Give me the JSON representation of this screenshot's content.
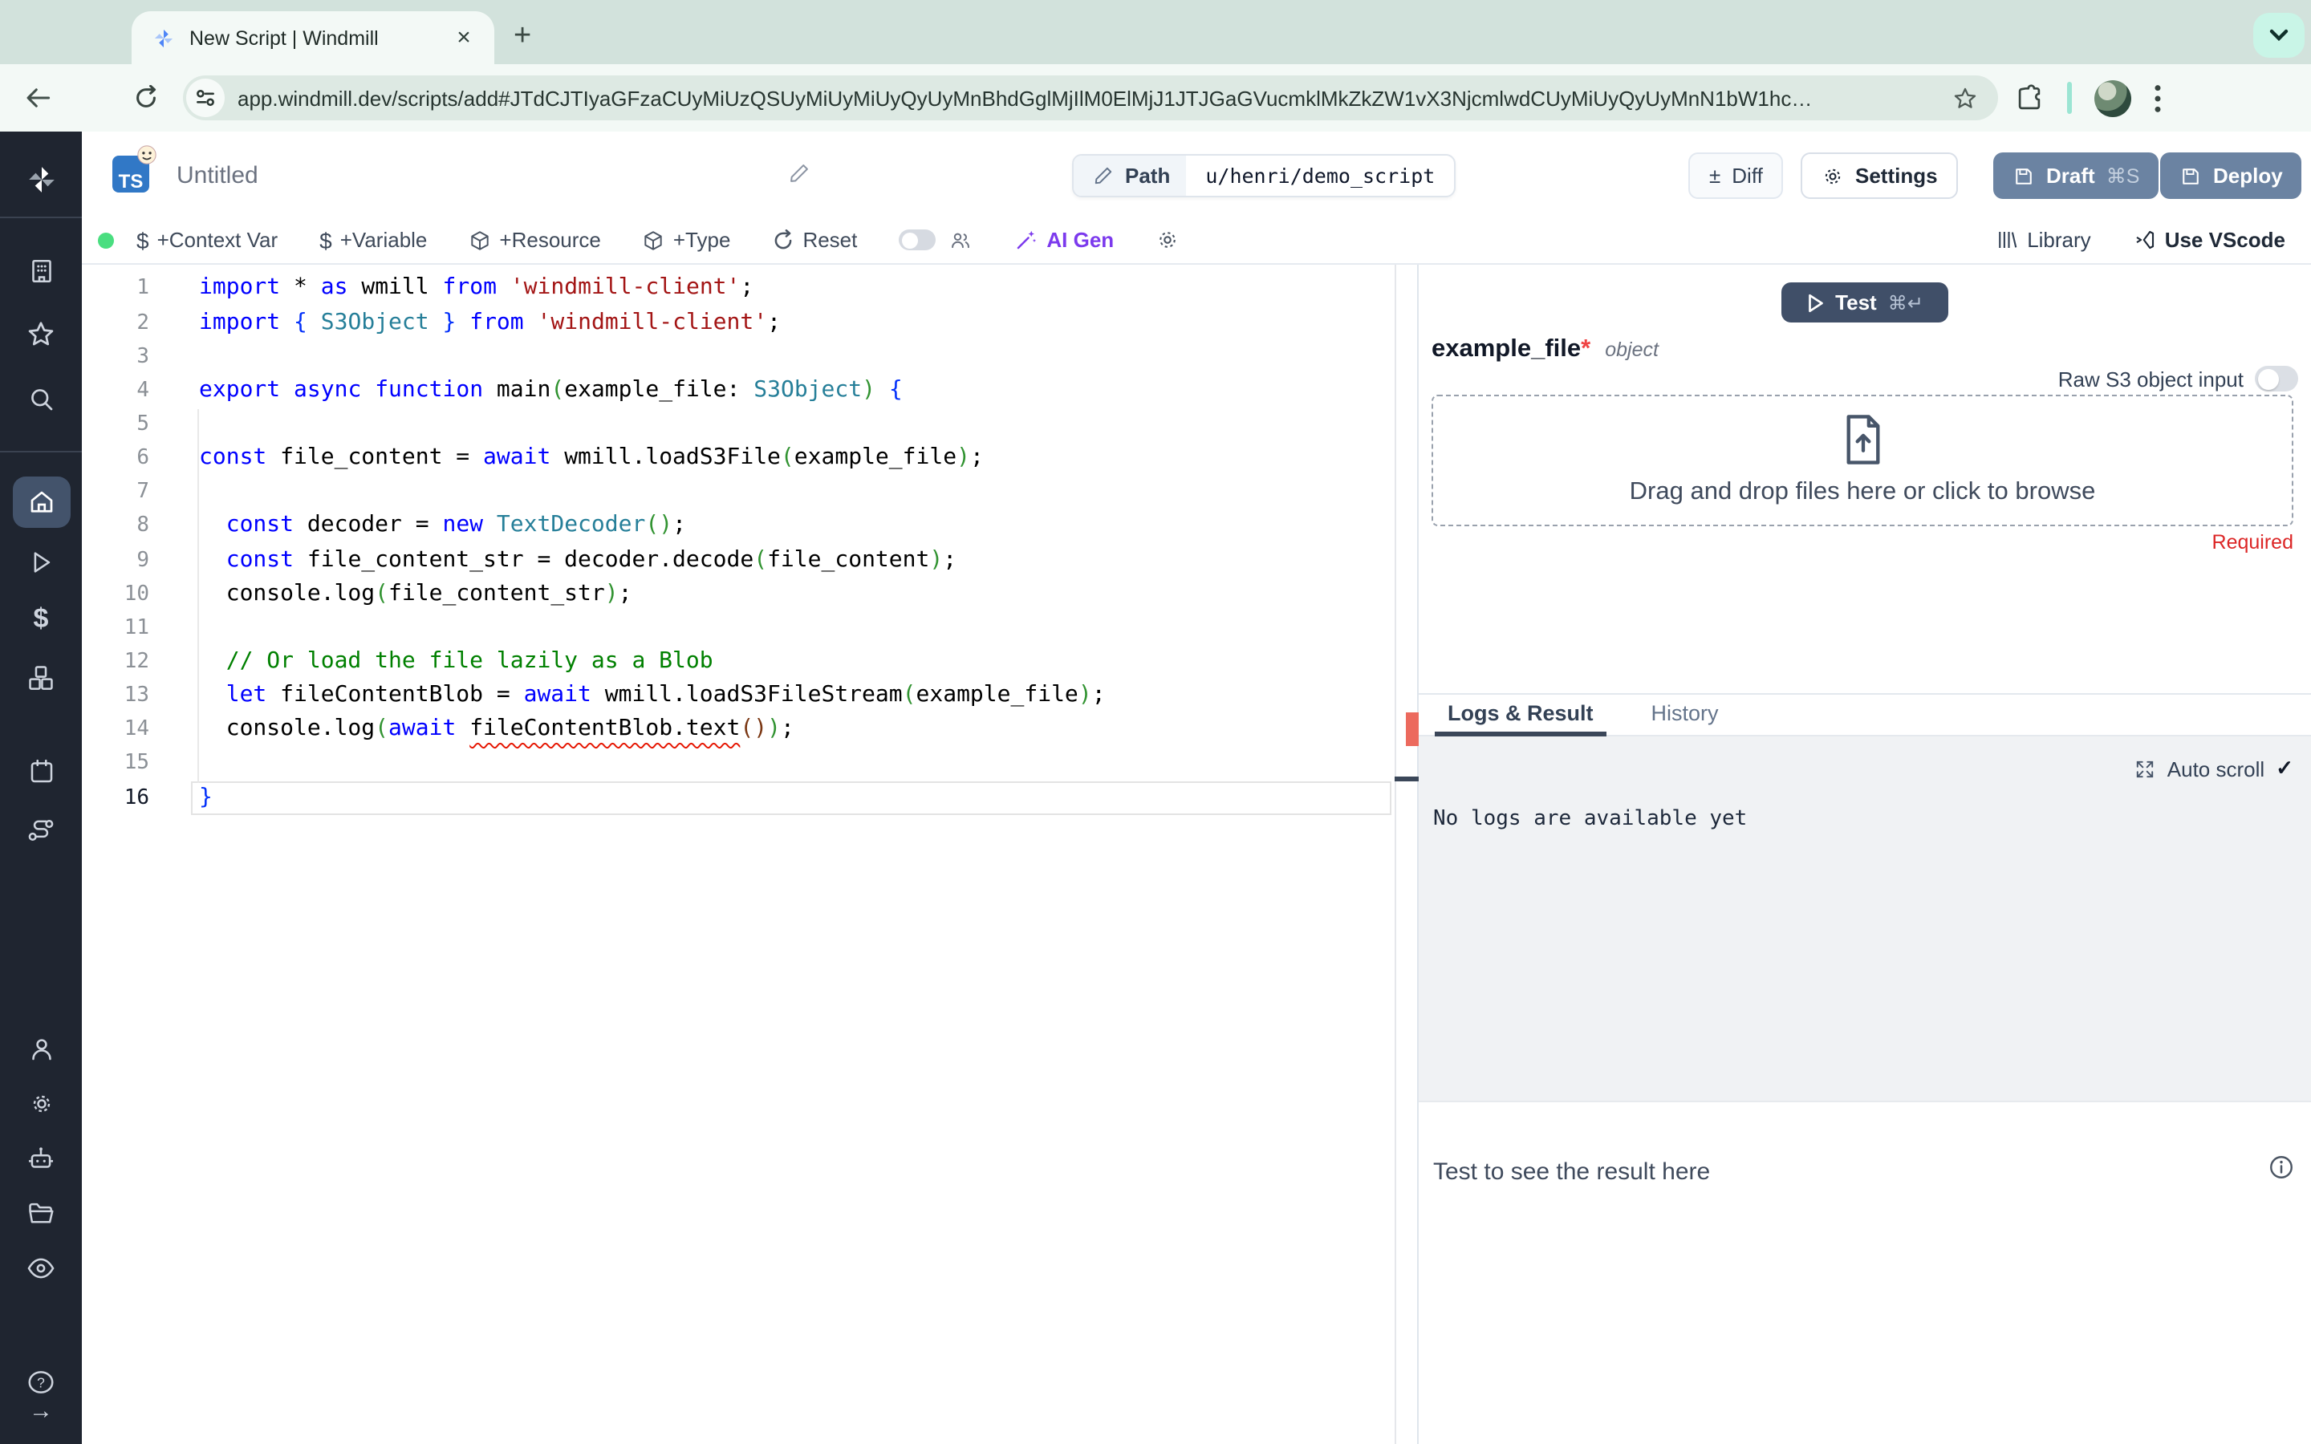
{
  "browser": {
    "tab_title": "New Script | Windmill",
    "tab_close": "×",
    "new_tab": "+",
    "url": "app.windmill.dev/scripts/add#JTdCJTIyaGFzaCUyMiUzQSUyMiUyMiUyQyUyMnBhdGglMjIlM0ElMjJ1JTJGaGVucmklMkZkZW1vX3NjcmlwdCUyMiUyQyUyMnN1bW1hc…"
  },
  "header": {
    "language_badge": "TS",
    "title": "Untitled",
    "path_label": "Path",
    "path_value": "u/henri/demo_script",
    "diff_symbol": "±",
    "diff_label": "Diff",
    "settings_label": "Settings",
    "draft_label": "Draft",
    "draft_shortcut": "⌘S",
    "deploy_label": "Deploy"
  },
  "toolbar": {
    "context_var": "+Context Var",
    "variable": "+Variable",
    "resource": "+Resource",
    "type": "+Type",
    "reset": "Reset",
    "ai_gen": "AI Gen",
    "library": "Library",
    "vscode": "Use VScode"
  },
  "sidebar": {
    "active": "home",
    "icons": [
      "windmill-logo",
      "building",
      "star",
      "search",
      "home",
      "play",
      "dollar",
      "cubes",
      "calendar",
      "route",
      "person",
      "gear",
      "robot",
      "folder",
      "eye",
      "help",
      "arrow-right"
    ]
  },
  "editor": {
    "lines": [
      {
        "n": 1,
        "tokens": [
          [
            "k",
            "import "
          ],
          [
            "p",
            "* "
          ],
          [
            "k",
            "as "
          ],
          [
            "p",
            "wmill "
          ],
          [
            "k",
            "from "
          ],
          [
            "s",
            "'windmill-client'"
          ],
          [
            "p",
            ";"
          ]
        ]
      },
      {
        "n": 2,
        "tokens": [
          [
            "k",
            "import "
          ],
          [
            "b1",
            "{ "
          ],
          [
            "t",
            "S3Object"
          ],
          [
            "b1",
            " } "
          ],
          [
            "k",
            "from "
          ],
          [
            "s",
            "'windmill-client'"
          ],
          [
            "p",
            ";"
          ]
        ]
      },
      {
        "n": 3,
        "tokens": []
      },
      {
        "n": 4,
        "tokens": [
          [
            "k",
            "export "
          ],
          [
            "k",
            "async "
          ],
          [
            "k",
            "function "
          ],
          [
            "p",
            "main"
          ],
          [
            "b2",
            "("
          ],
          [
            "p",
            "example_file: "
          ],
          [
            "t",
            "S3Object"
          ],
          [
            "b2",
            ")"
          ],
          [
            "p",
            " "
          ],
          [
            "b1",
            "{"
          ]
        ]
      },
      {
        "n": 5,
        "tokens": []
      },
      {
        "n": 6,
        "tokens": [
          [
            "k",
            "const "
          ],
          [
            "p",
            "file_content = "
          ],
          [
            "k",
            "await "
          ],
          [
            "p",
            "wmill.loadS3File"
          ],
          [
            "b2",
            "("
          ],
          [
            "p",
            "example_file"
          ],
          [
            "b2",
            ")"
          ],
          [
            "p",
            ";"
          ]
        ]
      },
      {
        "n": 7,
        "tokens": []
      },
      {
        "n": 8,
        "tokens": [
          [
            "p",
            "  "
          ],
          [
            "k",
            "const "
          ],
          [
            "p",
            "decoder = "
          ],
          [
            "k",
            "new "
          ],
          [
            "t",
            "TextDecoder"
          ],
          [
            "b2",
            "()"
          ],
          [
            "p",
            ";"
          ]
        ]
      },
      {
        "n": 9,
        "tokens": [
          [
            "p",
            "  "
          ],
          [
            "k",
            "const "
          ],
          [
            "p",
            "file_content_str = decoder.decode"
          ],
          [
            "b2",
            "("
          ],
          [
            "p",
            "file_content"
          ],
          [
            "b2",
            ")"
          ],
          [
            "p",
            ";"
          ]
        ]
      },
      {
        "n": 10,
        "tokens": [
          [
            "p",
            "  console.log"
          ],
          [
            "b2",
            "("
          ],
          [
            "p",
            "file_content_str"
          ],
          [
            "b2",
            ")"
          ],
          [
            "p",
            ";"
          ]
        ]
      },
      {
        "n": 11,
        "tokens": []
      },
      {
        "n": 12,
        "tokens": [
          [
            "p",
            "  "
          ],
          [
            "c",
            "// Or load the file lazily as a Blob"
          ]
        ]
      },
      {
        "n": 13,
        "tokens": [
          [
            "p",
            "  "
          ],
          [
            "k",
            "let "
          ],
          [
            "p",
            "fileContentBlob = "
          ],
          [
            "k",
            "await "
          ],
          [
            "p",
            "wmill.loadS3FileStream"
          ],
          [
            "b2",
            "("
          ],
          [
            "p",
            "example_file"
          ],
          [
            "b2",
            ")"
          ],
          [
            "p",
            ";"
          ]
        ]
      },
      {
        "n": 14,
        "tokens": [
          [
            "p",
            "  console.log"
          ],
          [
            "b2",
            "("
          ],
          [
            "k",
            "await "
          ],
          [
            "w",
            "fileContentBlob.text"
          ],
          [
            "b3",
            "()"
          ],
          [
            "b2",
            ")"
          ],
          [
            "p",
            ";"
          ]
        ]
      },
      {
        "n": 15,
        "tokens": []
      },
      {
        "n": 16,
        "active": true,
        "tokens": [
          [
            "b1",
            "}"
          ]
        ]
      }
    ]
  },
  "preview_panel": {
    "test_label": "Test",
    "test_shortcut": "⌘↵",
    "arg_name": "example_file",
    "required_star": "*",
    "arg_type": "object",
    "raw_s3_label": "Raw S3 object input",
    "dropzone_label": "Drag and drop files here or click to browse",
    "required_label": "Required",
    "tab_logs": "Logs & Result",
    "tab_history": "History",
    "auto_scroll": "Auto scroll",
    "auto_scroll_check": "✓",
    "no_logs": "No logs are available yet",
    "result_placeholder": "Test to see the result here"
  },
  "colors": {
    "chrome_strip": "#d2e2dc",
    "chrome_toolbar": "#f3f9f6",
    "mint_pill": "#c9f5e7",
    "sidebar_bg": "#1f2530",
    "sidebar_active": "#43536b",
    "button_slate": "#6b83a2",
    "test_button": "#404f68",
    "status_green": "#4ade80",
    "ai_gen_violet": "#7c3aed",
    "required_red": "#dc2626",
    "error_marker": "#ec6a5e",
    "ts_badge_blue": "#3178c6"
  }
}
